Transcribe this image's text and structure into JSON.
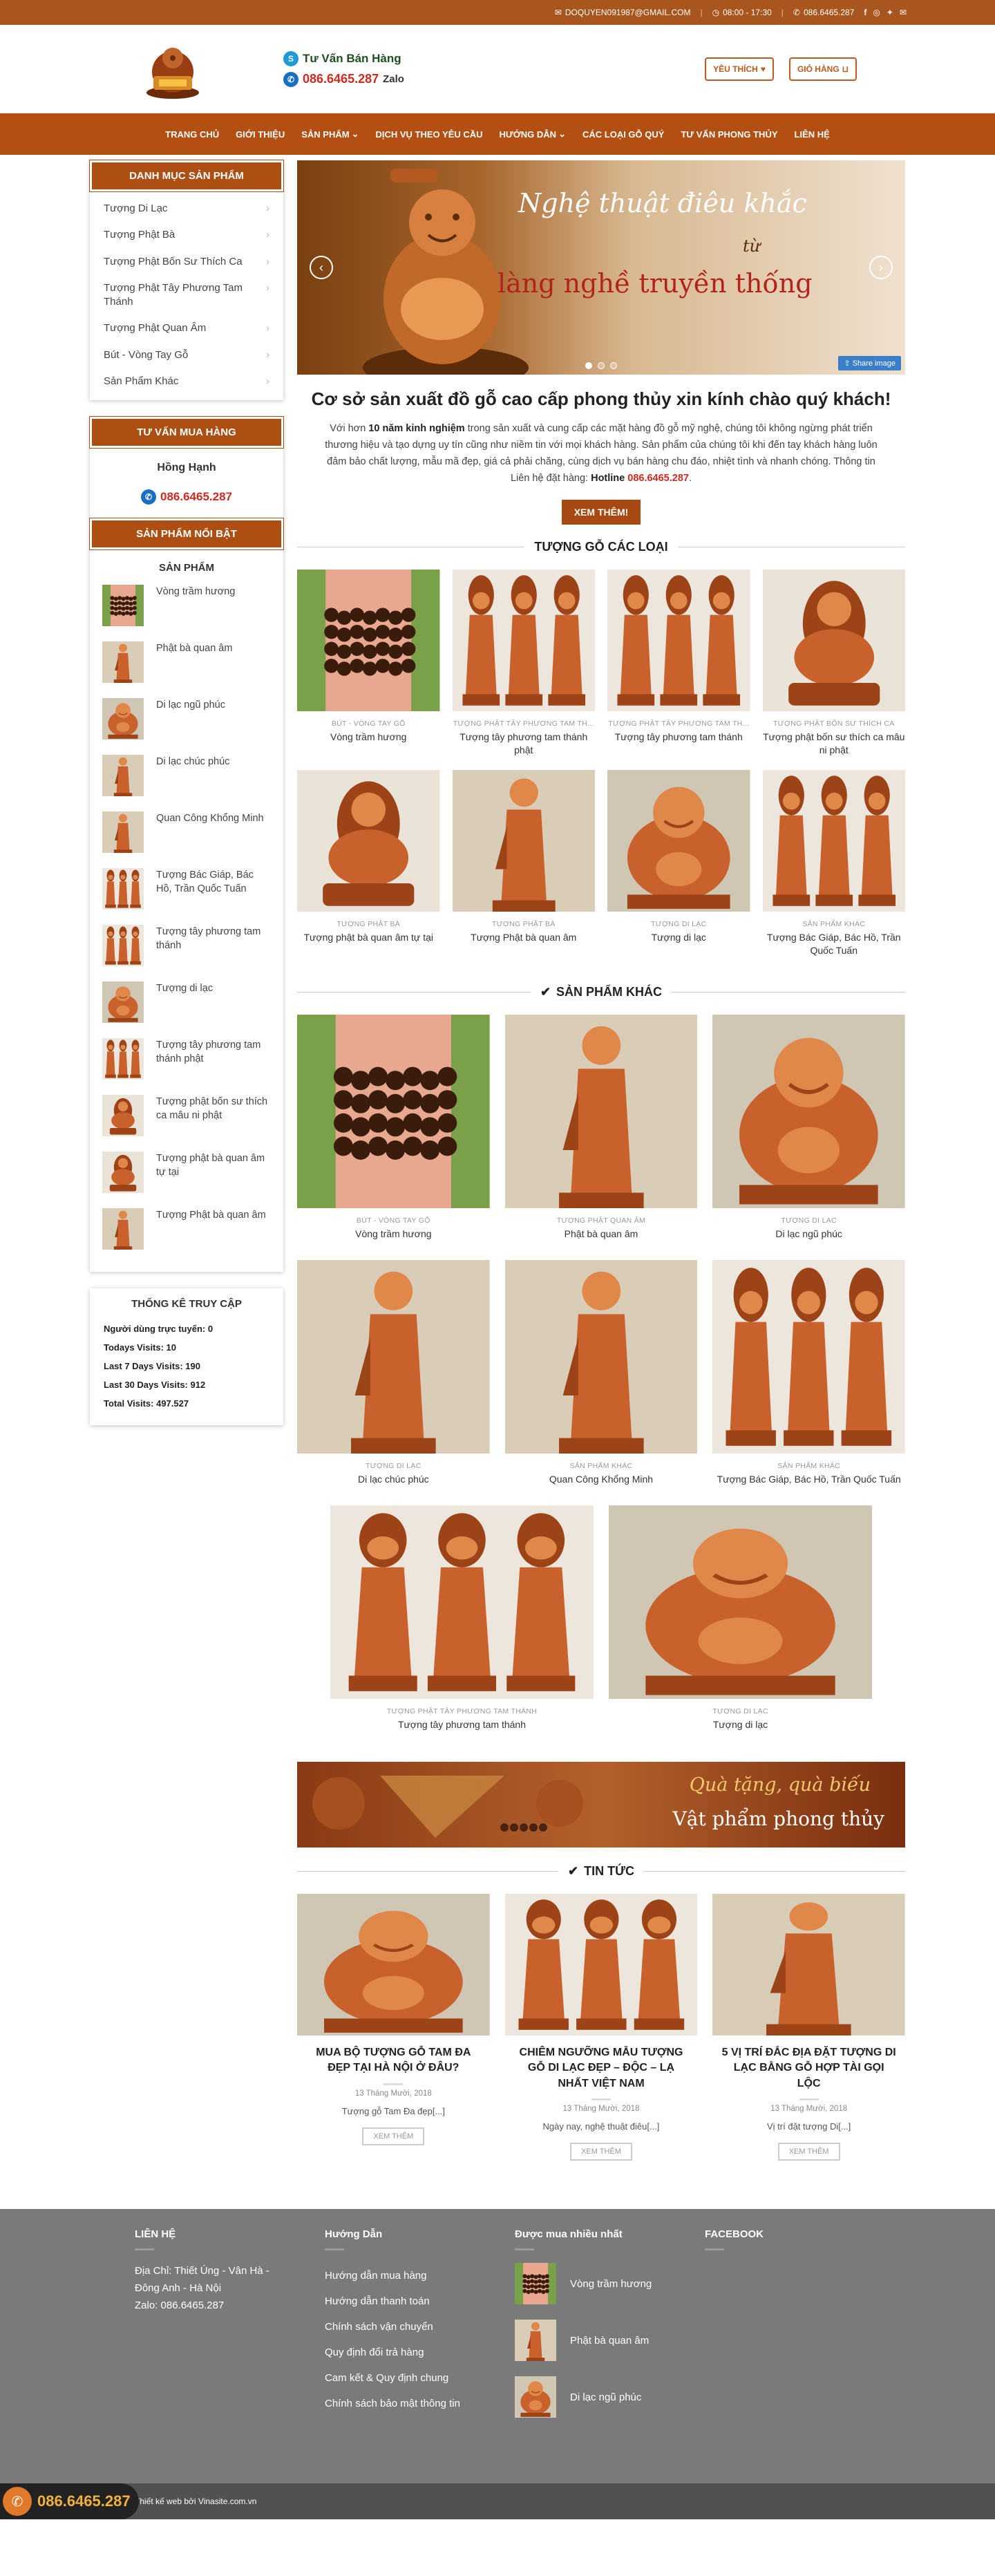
{
  "topbar": {
    "email": "DOQUYEN091987@GMAIL.COM",
    "hours": "08:00 - 17:30",
    "phone": "086.6465.287"
  },
  "header": {
    "consult_title": "Tư Vấn Bán Hàng",
    "consult_phone": "086.6465.287",
    "zalo_label": "Zalo",
    "favorite_label": "YÊU THÍCH",
    "cart_label": "GIỎ HÀNG"
  },
  "nav": [
    {
      "label": "TRANG CHỦ"
    },
    {
      "label": "GIỚI THIỆU"
    },
    {
      "label": "SẢN PHẨM",
      "dropdown": true
    },
    {
      "label": "DỊCH VỤ THEO YÊU CẦU"
    },
    {
      "label": "HƯỚNG DẪN",
      "dropdown": true
    },
    {
      "label": "CÁC LOẠI GỖ QUÝ"
    },
    {
      "label": "TƯ VẤN PHONG THỦY"
    },
    {
      "label": "LIÊN HỆ"
    }
  ],
  "sidebar": {
    "categories_title": "DANH MỤC SẢN PHẨM",
    "categories": [
      "Tượng Di Lạc",
      "Tượng Phật Bà",
      "Tượng Phật Bốn Sư Thích Ca",
      "Tượng Phật Tây Phương Tam Thánh",
      "Tượng Phật Quan Âm",
      "Bút - Vòng Tay Gỗ",
      "Sản Phẩm Khác"
    ],
    "advisor_title": "TƯ VẤN MUA HÀNG",
    "advisor_name": "Hồng Hạnh",
    "advisor_phone": "086.6465.287",
    "featured_title": "SẢN PHẨM NỔI BẬT",
    "products_title": "SẢN PHẨM",
    "products": [
      "Vòng trầm hương",
      "Phật bà quan âm",
      "Di lạc ngũ phúc",
      "Di lạc chúc phúc",
      "Quan Công Khổng Minh",
      "Tượng Bác Giáp, Bác Hồ, Trần Quốc Tuấn",
      "Tượng tây phương tam thánh",
      "Tượng di lạc",
      "Tượng tây phương tam thánh phật",
      "Tượng phật bốn sư thích ca mâu ni phật",
      "Tượng phật bà quan âm tự tại",
      "Tượng Phật bà quan âm"
    ],
    "stats_title": "THỐNG KÊ TRUY CẬP",
    "stats": [
      "Người dùng trực tuyến: 0",
      "Todays Visits: 10",
      "Last 7 Days Visits: 190",
      "Last 30 Days Visits: 912",
      "Total Visits: 497.527"
    ]
  },
  "slider": {
    "line1": "Nghệ thuật điêu khắc",
    "line2": "từ",
    "line3": "làng nghề truyền thống",
    "share": "Share image"
  },
  "welcome": {
    "title": "Cơ sở sản xuất đồ gỗ cao cấp phong thủy xin kính chào quý khách!",
    "p_a": "Với hơn ",
    "p_b": "10 năm kinh nghiệm",
    "p_c": " trong sản xuất và cung cấp các mặt hàng đồ gỗ mỹ nghệ, chúng tôi không ngừng phát triển thương hiệu và tạo dựng uy tín cũng như niềm tin với mọi khách hàng. Sản phẩm của chúng tôi khi đến tay khách hàng luôn đảm bảo chất lượng, mẫu mã đẹp, giá cả phải chăng, cùng dịch vụ bán hàng chu đáo, nhiệt tình và nhanh chóng. Thông tin Liên hệ đặt hàng: ",
    "p_d": "Hotline",
    "p_e": "086.6465.287",
    "p_f": ".",
    "button": "XEM THÊM!"
  },
  "section1": {
    "title": "TƯỢNG GỖ CÁC LOẠI",
    "items": [
      {
        "cat": "BÚT - VÒNG TAY GỖ",
        "name": "Vòng trầm hương",
        "kind": "bracelet"
      },
      {
        "cat": "TƯỢNG PHẬT TÂY PHƯƠNG TAM TH...",
        "name": "Tượng tây phương tam thánh phật",
        "kind": "trio"
      },
      {
        "cat": "TƯỢNG PHẬT TÂY PHƯƠNG TAM TH...",
        "name": "Tượng tây phương tam thánh",
        "kind": "trio"
      },
      {
        "cat": "TƯỢNG PHẬT BỐN SƯ THÍCH CA",
        "name": "Tượng phật bốn sư thích ca mâu ni phật",
        "kind": "seated"
      },
      {
        "cat": "TƯỢNG PHẬT BÀ",
        "name": "Tượng phật bà quan âm tự tại",
        "kind": "seated"
      },
      {
        "cat": "TƯỢNG PHẬT BÀ",
        "name": "Tượng Phật bà quan âm",
        "kind": "standing"
      },
      {
        "cat": "TƯỢNG DI LẠC",
        "name": "Tượng di lạc",
        "kind": "laughing"
      },
      {
        "cat": "SẢN PHẨM KHÁC",
        "name": "Tượng Bác Giáp, Bác Hồ, Trần Quốc Tuấn",
        "kind": "trio"
      }
    ]
  },
  "section2": {
    "title": "SẢN PHẨM KHÁC",
    "items": [
      {
        "cat": "BÚT - VÒNG TAY GỖ",
        "name": "Vòng trầm hương",
        "kind": "bracelet"
      },
      {
        "cat": "TƯỢNG PHẬT QUAN ÂM",
        "name": "Phật bà quan âm",
        "kind": "standing"
      },
      {
        "cat": "TƯỢNG DI LẠC",
        "name": "Di lạc ngũ phúc",
        "kind": "laughing"
      },
      {
        "cat": "TƯỢNG DI LẠC",
        "name": "Di lạc chúc phúc",
        "kind": "standing"
      },
      {
        "cat": "SẢN PHẨM KHÁC",
        "name": "Quan Công Khổng Minh",
        "kind": "standing"
      },
      {
        "cat": "SẢN PHẨM KHÁC",
        "name": "Tượng Bác Giáp, Bác Hồ, Trần Quốc Tuấn",
        "kind": "trio"
      },
      {
        "cat": "TƯỢNG PHẬT TÂY PHƯƠNG TAM THÁNH",
        "name": "Tượng tây phương tam thánh",
        "kind": "trio"
      },
      {
        "cat": "TƯỢNG DI LẠC",
        "name": "Tượng di lạc",
        "kind": "laughing"
      }
    ]
  },
  "banner": {
    "line1": "Quà tặng, quà biếu",
    "line2": "Vật phẩm phong thủy"
  },
  "news": {
    "title": "TIN TỨC",
    "read_more": "XEM THÊM",
    "items": [
      {
        "title": "MUA BỘ TƯỢNG GỖ TAM ĐA ĐẸP TẠI HÀ NỘI Ở ĐÂU?",
        "date": "13 Tháng Mười, 2018",
        "excerpt": "Tượng gỗ Tam Đa đẹp[...]",
        "kind": "laughing"
      },
      {
        "title": "CHIÊM NGƯỠNG MẪU TƯỢNG GỖ DI LẠC ĐẸP – ĐỘC – LẠ NHẤT VIỆT NAM",
        "date": "13 Tháng Mười, 2018",
        "excerpt": "Ngày nay, nghệ thuật điêu[...]",
        "kind": "trio"
      },
      {
        "title": "5 VỊ TRÍ ĐẮC ĐỊA ĐẶT TƯỢNG DI LẠC BẰNG GỖ HỢP TÀI GỌI LỘC",
        "date": "13 Tháng Mười, 2018",
        "excerpt": "Vị trí đặt tượng Di[...]",
        "kind": "standing"
      }
    ]
  },
  "footer": {
    "contact_title": "LIÊN HỆ",
    "address": "Địa Chỉ: Thiết Úng - Vân Hà - Đông Anh - Hà Nội",
    "zalo": "Zalo: 086.6465.287",
    "guide_title": "Hướng Dẫn",
    "guide_links": [
      "Hướng dẫn mua hàng",
      "Hướng dẫn thanh toán",
      "Chính sách vận chuyển",
      "Quy định đổi trả hàng",
      "Cam kết & Quy định chung",
      "Chính sách bảo mật thông tin"
    ],
    "popular_title": "Được mua nhiều nhất",
    "popular": [
      {
        "name": "Vòng trầm hương",
        "kind": "bracelet"
      },
      {
        "name": "Phật bà quan âm",
        "kind": "standing"
      },
      {
        "name": "Di lạc ngũ phúc",
        "kind": "laughing"
      }
    ],
    "facebook_title": "FACEBOOK",
    "credit": "Thiết kế web bởi Vinasite.com.vn",
    "call_number": "086.6465.287"
  },
  "colors": {
    "brand": "#b34f12",
    "topbar": "#a8561d",
    "hotline": "#d4291f",
    "footer": "#7a7a7a"
  }
}
